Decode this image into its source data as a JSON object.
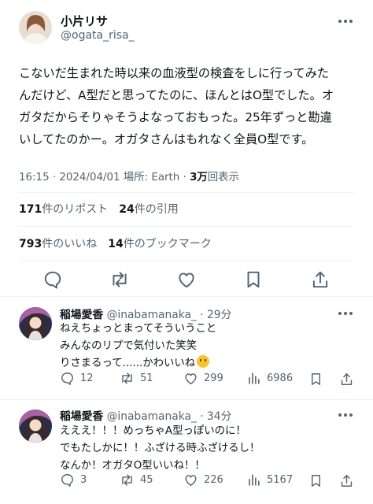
{
  "post": {
    "display_name": "小片リサ",
    "handle": "@ogata_risa_",
    "text": "こないだ生まれた時以来の血液型の検査をしに行ってみた\nんだけど、A型だと思ってたのに、ほんとはO型でした。オ\nガタだからそりゃそうよなっておもった。25年ずっと勘違\nいしてたのかー。オガタさんはもれなく全員O型です。",
    "time": "16:15",
    "date": "2024/04/01",
    "location_label": "場所: Earth",
    "views_count": "3万",
    "views_label": "回表示",
    "reposts_count": "171",
    "reposts_label": "件のリポスト",
    "quotes_count": "24",
    "quotes_label": "件の引用",
    "likes_count": "793",
    "likes_label": "件のいいね",
    "bookmarks_count": "14",
    "bookmarks_label": "件のブックマーク"
  },
  "replies": [
    {
      "display_name": "稲場愛香",
      "handle": "@inabamanaka_",
      "time_ago": "29分",
      "text": "ねえちょっとまってそういうこと\nみんなのリプで気付いた笑笑\nりさまるって......かわいいね",
      "emoji_icon": "shushing-face-emoji",
      "replies": "12",
      "reposts": "51",
      "likes": "299",
      "views": "6986"
    },
    {
      "display_name": "稲場愛香",
      "handle": "@inabamanaka_",
      "time_ago": "34分",
      "text": "えええ！！！めっちゃA型っぽいのに！\nでもたしかに！！ふざける時ふざけるし！\nなんか！オガタO型いいね！！",
      "replies": "3",
      "reposts": "45",
      "likes": "226",
      "views": "5167"
    }
  ],
  "colors": {
    "text": "#0f1419",
    "secondary": "#536471",
    "divider": "#eff3f4"
  }
}
